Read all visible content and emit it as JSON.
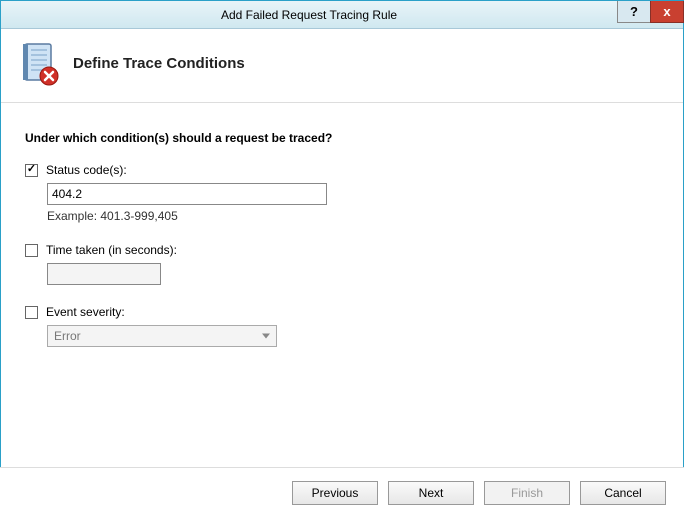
{
  "window": {
    "title": "Add Failed Request Tracing Rule",
    "help_symbol": "?",
    "close_symbol": "x"
  },
  "header": {
    "title": "Define Trace Conditions"
  },
  "prompt": "Under which condition(s) should a request be traced?",
  "status_codes": {
    "checked": true,
    "label": "Status code(s):",
    "value": "404.2",
    "example": "Example: 401.3-999,405"
  },
  "time_taken": {
    "checked": false,
    "label": "Time taken (in seconds):",
    "value": ""
  },
  "event_severity": {
    "checked": false,
    "label": "Event severity:",
    "selected": "Error"
  },
  "buttons": {
    "previous": "Previous",
    "next": "Next",
    "finish": "Finish",
    "cancel": "Cancel"
  }
}
